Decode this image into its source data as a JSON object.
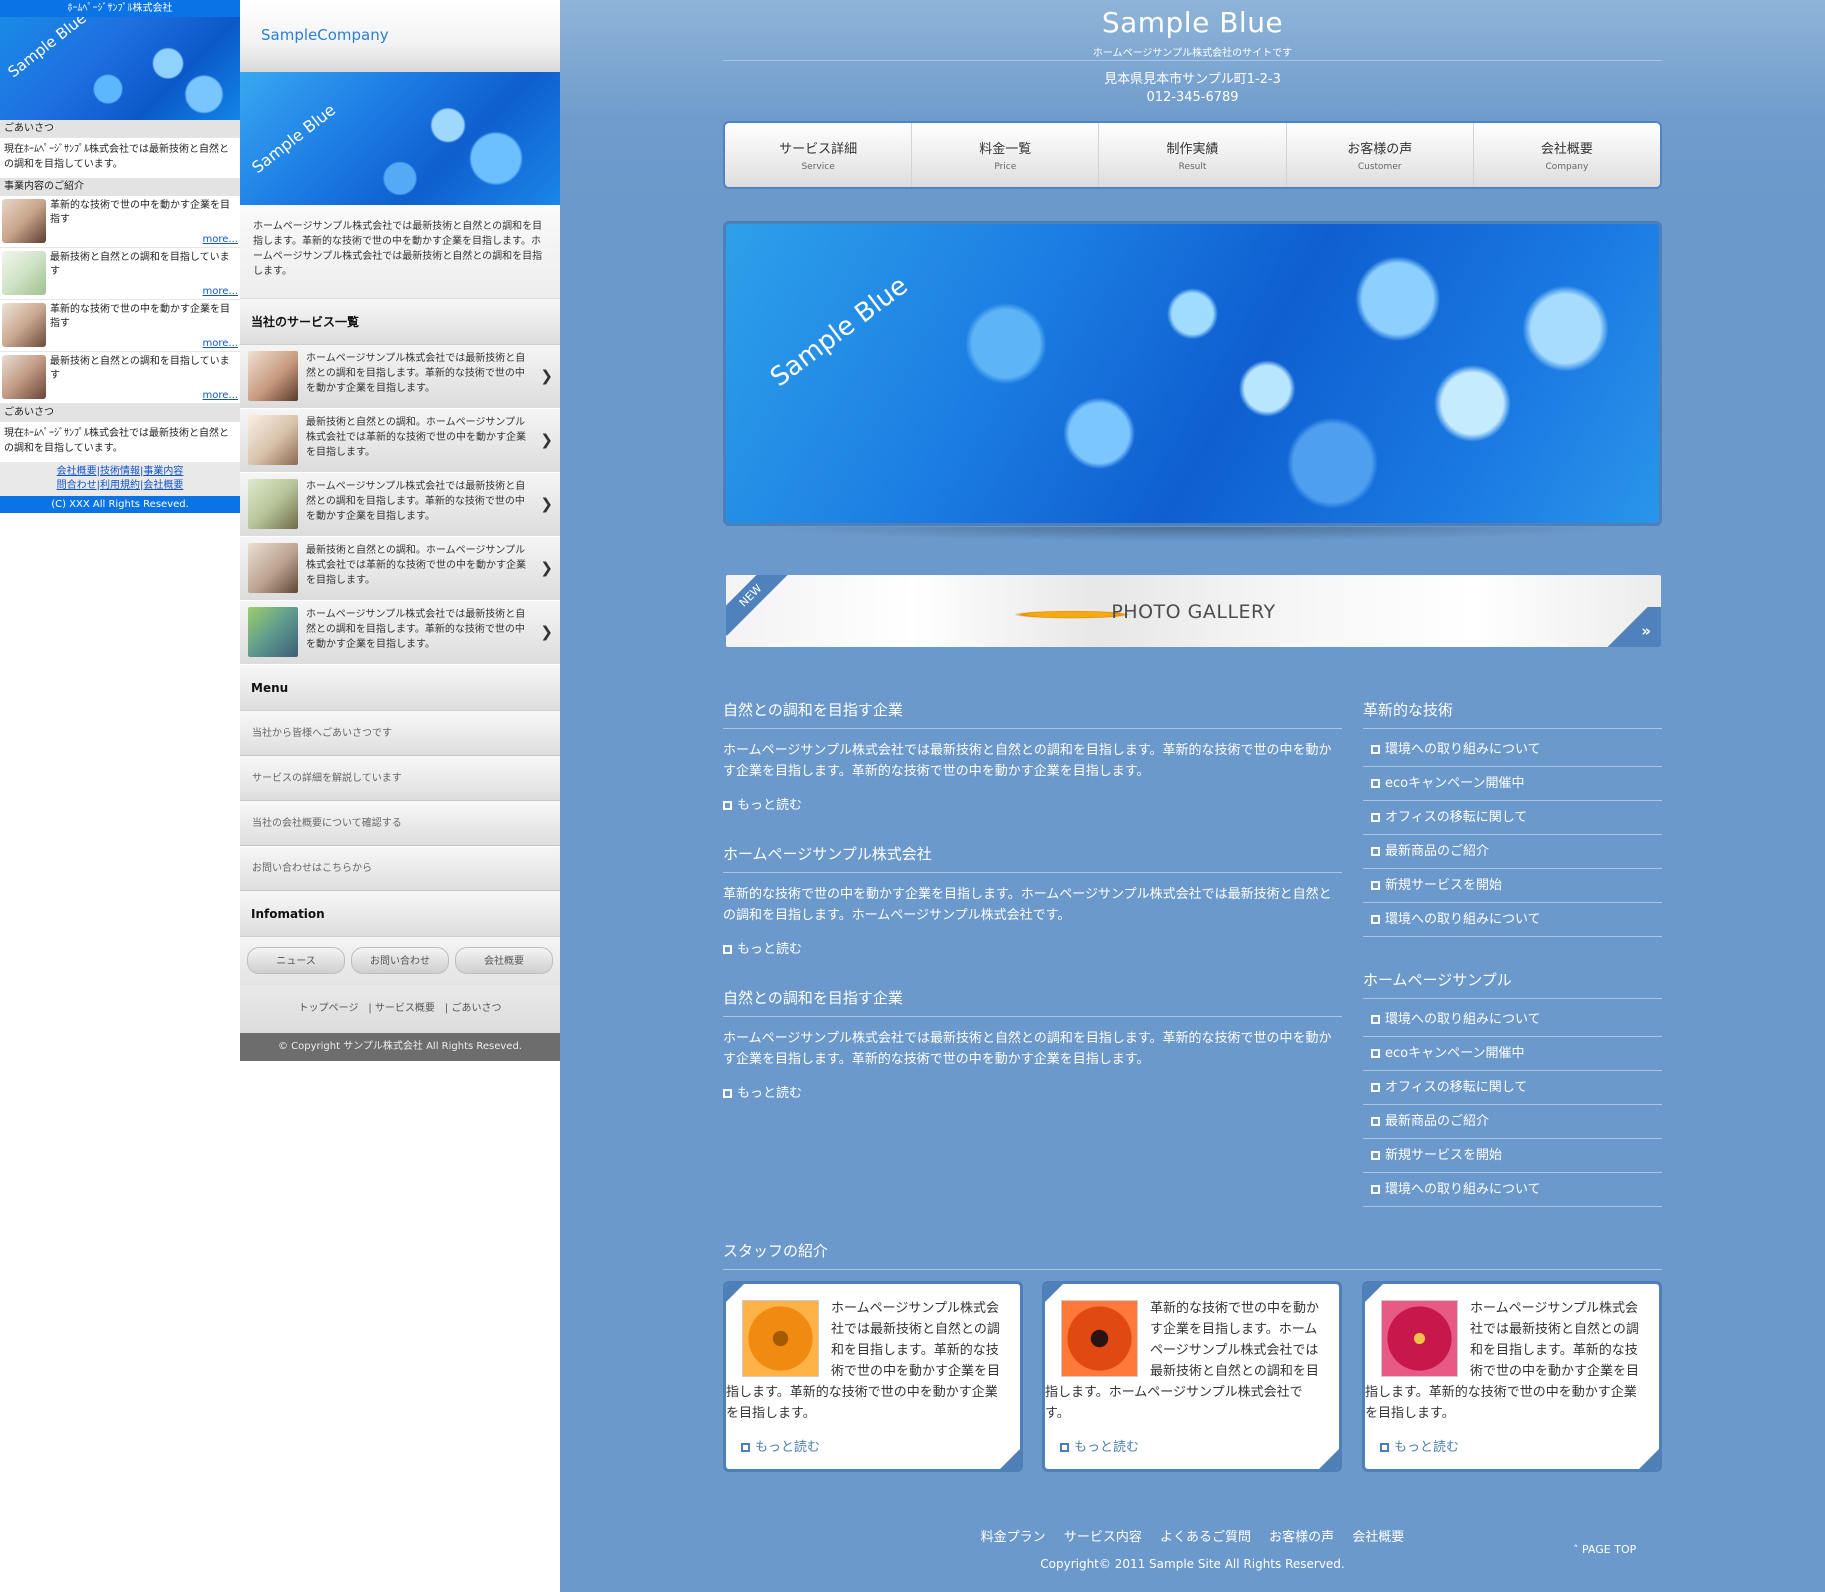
{
  "colors": {
    "fp_accent": "#0a74e6",
    "pc_background": "#6b99cb",
    "pc_border": "#4e7fb6",
    "link": "#1155cc"
  },
  "feature_phone": {
    "title": "ﾎｰﾑﾍﾟｰｼﾞｻﾝﾌﾟﾙ株式会社",
    "hero_text": "Sample Blue",
    "greeting_label": "ごあいさつ",
    "greeting_text": "現在ﾎｰﾑﾍﾟｰｼﾞｻﾝﾌﾟﾙ株式会社では最新技術と自然との調和を目指しています。",
    "business_label": "事業内容のご紹介",
    "items": [
      {
        "text": "革新的な技術で世の中を動かす企業を目指す",
        "more": "more..."
      },
      {
        "text": "最新技術と自然との調和を目指しています",
        "more": "more..."
      },
      {
        "text": "革新的な技術で世の中を動かす企業を目指す",
        "more": "more..."
      },
      {
        "text": "最新技術と自然との調和を目指しています",
        "more": "more..."
      }
    ],
    "greeting2_label": "ごあいさつ",
    "greeting2_text": "現在ﾎｰﾑﾍﾟｰｼﾞｻﾝﾌﾟﾙ株式会社では最新技術と自然との調和を目指しています。",
    "links": [
      "会社概要",
      "技術情報",
      "事業内容",
      "問合わせ",
      "利用規約",
      "会社概要"
    ],
    "copyright": "(C) XXX All Rights Reseved."
  },
  "smartphone": {
    "logo": "SampleCompany",
    "hero_text": "Sample Blue",
    "intro": "ホームページサンプル株式会社では最新技術と自然との調和を目指します。革新的な技術で世の中を動かす企業を目指します。ホームページサンプル株式会社では最新技術と自然との調和を目指します。",
    "services_heading": "当社のサービス一覧",
    "services": [
      "ホームページサンプル株式会社では最新技術と自然との調和を目指します。革新的な技術で世の中を動かす企業を目指します。",
      "最新技術と自然との調和。ホームページサンプル株式会社では革新的な技術で世の中を動かす企業を目指します。",
      "ホームページサンプル株式会社では最新技術と自然との調和を目指します。革新的な技術で世の中を動かす企業を目指します。",
      "最新技術と自然との調和。ホームページサンプル株式会社では革新的な技術で世の中を動かす企業を目指します。",
      "ホームページサンプル株式会社では最新技術と自然との調和を目指します。革新的な技術で世の中を動かす企業を目指します。"
    ],
    "menu_heading": "Menu",
    "menu": [
      "当社から皆様へごあいさつです",
      "サービスの詳細を解説しています",
      "当社の会社概要について確認する",
      "お問い合わせはこちらから"
    ],
    "info_heading": "Infomation",
    "buttons": [
      "ニュース",
      "お問い合わせ",
      "会社概要"
    ],
    "foot_links": "トップページ　| サービス概要　| ごあいさつ",
    "copyright": "© Copyright サンプル株式会社 All Rights Reseved."
  },
  "pc": {
    "site_title": "Sample Blue",
    "tagline": "ホームページサンプル株式会社のサイトです",
    "address": "見本県見本市サンプル町1-2-3",
    "phone": "012-345-6789",
    "nav": [
      {
        "jp": "サービス詳細",
        "en": "Service"
      },
      {
        "jp": "料金一覧",
        "en": "Price"
      },
      {
        "jp": "制作実績",
        "en": "Result"
      },
      {
        "jp": "お客様の声",
        "en": "Customer"
      },
      {
        "jp": "会社概要",
        "en": "Company"
      }
    ],
    "main_visual_text": "Sample Blue",
    "gallery": {
      "badge": "NEW",
      "label": "PHOTO GALLERY",
      "arrow": "»"
    },
    "articles": [
      {
        "title": "自然との調和を目指す企業",
        "body": "ホームページサンプル株式会社では最新技術と自然との調和を目指します。革新的な技術で世の中を動かす企業を目指します。革新的な技術で世の中を動かす企業を目指します。",
        "more": "もっと読む"
      },
      {
        "title": "ホームページサンプル株式会社",
        "body": "革新的な技術で世の中を動かす企業を目指します。ホームページサンプル株式会社では最新技術と自然との調和を目指します。ホームページサンプル株式会社です。",
        "more": "もっと読む"
      },
      {
        "title": "自然との調和を目指す企業",
        "body": "ホームページサンプル株式会社では最新技術と自然との調和を目指します。革新的な技術で世の中を動かす企業を目指します。革新的な技術で世の中を動かす企業を目指します。",
        "more": "もっと読む"
      }
    ],
    "side1": {
      "title": "革新的な技術",
      "items": [
        "環境への取り組みについて",
        "ecoキャンペーン開催中",
        "オフィスの移転に関して",
        "最新商品のご紹介",
        "新規サービスを開始",
        "環境への取り組みについて"
      ]
    },
    "side2": {
      "title": "ホームページサンプル",
      "items": [
        "環境への取り組みについて",
        "ecoキャンペーン開催中",
        "オフィスの移転に関して",
        "最新商品のご紹介",
        "新規サービスを開始",
        "環境への取り組みについて"
      ]
    },
    "staff_heading": "スタッフの紹介",
    "staff": [
      {
        "text": "ホームページサンプル株式会社では最新技術と自然との調和を目指します。革新的な技術で世の中を動かす企業を目指します。革新的な技術で世の中を動かす企業を目指します。",
        "more": "もっと読む"
      },
      {
        "text": "革新的な技術で世の中を動かす企業を目指します。ホームページサンプル株式会社では最新技術と自然との調和を目指します。ホームページサンプル株式会社です。",
        "more": "もっと読む"
      },
      {
        "text": "ホームページサンプル株式会社では最新技術と自然との調和を目指します。革新的な技術で世の中を動かす企業を目指します。革新的な技術で世の中を動かす企業を目指します。",
        "more": "もっと読む"
      }
    ],
    "footer_links": [
      "料金プラン",
      "サービス内容",
      "よくあるご質問",
      "お客様の声",
      "会社概要"
    ],
    "copyright": "Copyright© 2011 Sample Site All Rights Reserved.",
    "page_top": "PAGE TOP"
  }
}
